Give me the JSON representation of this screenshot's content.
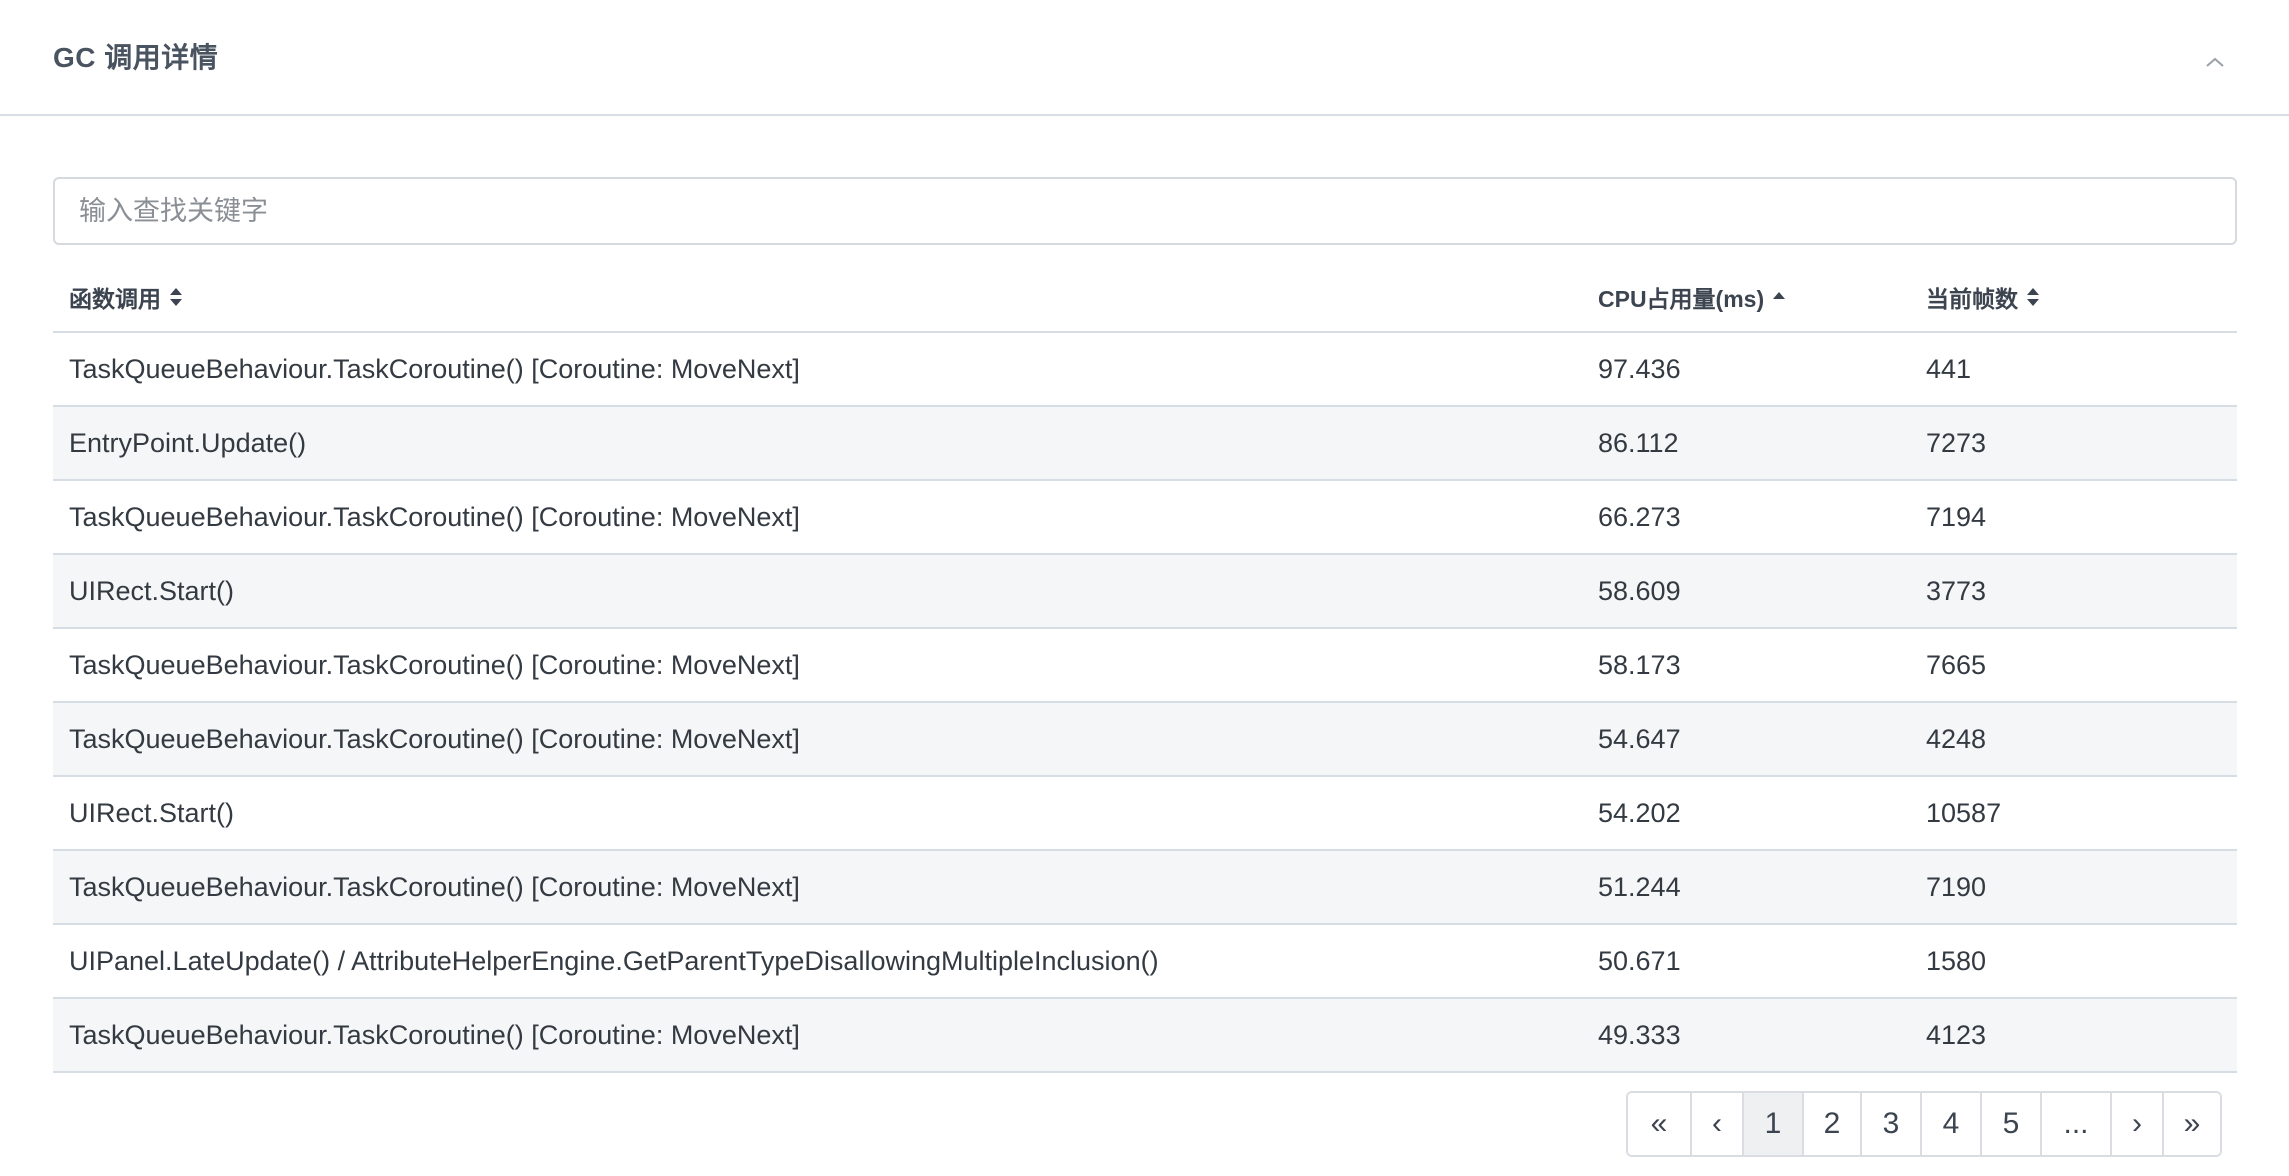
{
  "panel": {
    "title": "GC 调用详情",
    "collapse_icon": "chevron-up-icon"
  },
  "search": {
    "placeholder": "输入查找关键字",
    "value": ""
  },
  "table": {
    "columns": [
      {
        "label": "函数调用",
        "sort": "both",
        "sort_icon": "sort-icon"
      },
      {
        "label": "CPU占用量(ms)",
        "sort": "ascending",
        "sort_icon": "sort-up-icon"
      },
      {
        "label": "当前帧数",
        "sort": "both",
        "sort_icon": "sort-icon"
      }
    ],
    "rows": [
      {
        "func": "TaskQueueBehaviour.TaskCoroutine() [Coroutine: MoveNext]",
        "cpu": "97.436",
        "frame": "441"
      },
      {
        "func": "EntryPoint.Update()",
        "cpu": "86.112",
        "frame": "7273"
      },
      {
        "func": "TaskQueueBehaviour.TaskCoroutine() [Coroutine: MoveNext]",
        "cpu": "66.273",
        "frame": "7194"
      },
      {
        "func": "UIRect.Start()",
        "cpu": "58.609",
        "frame": "3773"
      },
      {
        "func": "TaskQueueBehaviour.TaskCoroutine() [Coroutine: MoveNext]",
        "cpu": "58.173",
        "frame": "7665"
      },
      {
        "func": "TaskQueueBehaviour.TaskCoroutine() [Coroutine: MoveNext]",
        "cpu": "54.647",
        "frame": "4248"
      },
      {
        "func": "UIRect.Start()",
        "cpu": "54.202",
        "frame": "10587"
      },
      {
        "func": "TaskQueueBehaviour.TaskCoroutine() [Coroutine: MoveNext]",
        "cpu": "51.244",
        "frame": "7190"
      },
      {
        "func": "UIPanel.LateUpdate() / AttributeHelperEngine.GetParentTypeDisallowingMultipleInclusion()",
        "cpu": "50.671",
        "frame": "1580"
      },
      {
        "func": "TaskQueueBehaviour.TaskCoroutine() [Coroutine: MoveNext]",
        "cpu": "49.333",
        "frame": "4123"
      }
    ]
  },
  "pagination": {
    "items": [
      {
        "label": "«",
        "name": "first"
      },
      {
        "label": "‹",
        "name": "prev"
      },
      {
        "label": "1",
        "name": "1",
        "active": true
      },
      {
        "label": "2",
        "name": "2"
      },
      {
        "label": "3",
        "name": "3"
      },
      {
        "label": "4",
        "name": "4"
      },
      {
        "label": "5",
        "name": "5"
      },
      {
        "label": "...",
        "name": "ellipsis"
      },
      {
        "label": "›",
        "name": "next"
      },
      {
        "label": "»",
        "name": "last"
      }
    ]
  }
}
